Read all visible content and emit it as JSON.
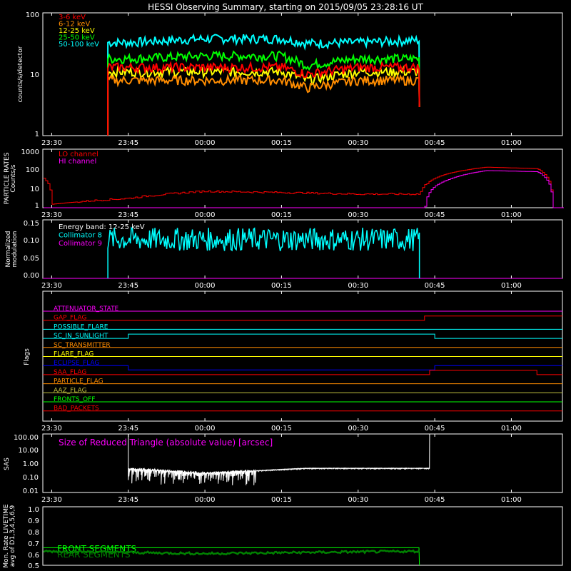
{
  "title": "HESSI Observing Summary, starting on 2015/09/05 23:28:16 UT",
  "time_ticks": [
    "23:30",
    "23:45",
    "00:00",
    "00:15",
    "00:30",
    "00:45",
    "01:00"
  ],
  "panels": {
    "counts": {
      "ylabel": "counts/s/detector",
      "ticks": [
        "100",
        "10",
        "1"
      ],
      "legend": [
        {
          "label": "3-6 keV",
          "color": "#ff0000"
        },
        {
          "label": "6-12 keV",
          "color": "#ff8c00"
        },
        {
          "label": "12-25 keV",
          "color": "#ffff00"
        },
        {
          "label": "25-50 keV",
          "color": "#00ff00"
        },
        {
          "label": "50-100 keV",
          "color": "#00ffff"
        }
      ]
    },
    "particle": {
      "ylabel1": "PARTICLE RATES",
      "ylabel2": "Counts/s",
      "ticks": [
        "1000",
        "100",
        "10",
        "1"
      ],
      "legend": [
        {
          "label": "LO channel",
          "color": "#ff0000"
        },
        {
          "label": "HI channel",
          "color": "#ff00ff"
        }
      ]
    },
    "modulation": {
      "ylabel1": "Normalized",
      "ylabel2": "modulation",
      "ticks": [
        "0.15",
        "0.10",
        "0.05",
        "0.00"
      ],
      "legend": [
        {
          "label": "Energy band: 12-25 keV",
          "color": "#ffffff"
        },
        {
          "label": "Collimator 8",
          "color": "#00ffff"
        },
        {
          "label": "Collimator 9",
          "color": "#ff00ff"
        }
      ]
    },
    "flags": {
      "ylabel": "Flags",
      "items": [
        {
          "label": "ATTENUATOR_STATE",
          "color": "#ff00ff"
        },
        {
          "label": "GAP_FLAG",
          "color": "#ff0000"
        },
        {
          "label": "POSSIBLE_FLARE",
          "color": "#00ffff"
        },
        {
          "label": "SC_IN_SUNLIGHT",
          "color": "#00ffff"
        },
        {
          "label": "SC_TRANSMITTER",
          "color": "#ff8c00"
        },
        {
          "label": "FLARE_FLAG",
          "color": "#ffff00"
        },
        {
          "label": "ECLIPSE_FLAG",
          "color": "#0000ff"
        },
        {
          "label": "SAA_FLAG",
          "color": "#ff0000"
        },
        {
          "label": "PARTICLE_FLAG",
          "color": "#ff8c00"
        },
        {
          "label": "AAZ_FLAG",
          "color": "#c0c040"
        },
        {
          "label": "FRONTS_OFF",
          "color": "#00ff00"
        },
        {
          "label": "BAD_PACKETS",
          "color": "#ff0000"
        }
      ]
    },
    "sas": {
      "ylabel": "SAS",
      "ticks": [
        "100.00",
        "10.00",
        "1.00",
        "0.10",
        "0.01"
      ],
      "label": "Size of Reduced Triangle (absolute value) [arcsec]",
      "label_color": "#ff00ff"
    },
    "livetime": {
      "ylabel1": "Mon. Rate LIVETIME",
      "ylabel2": "avg of D1,3,4,5,6,9",
      "ticks": [
        "1.0",
        "0.9",
        "0.8",
        "0.7",
        "0.6",
        "0.5"
      ],
      "legend": [
        {
          "label": "FRONT SEGMENTS",
          "color": "#00ff00"
        },
        {
          "label": "REAR SEGMENTS",
          "color": "#008000"
        }
      ]
    }
  },
  "chart_data": [
    {
      "type": "line",
      "title": "HESSI Observing Summary, starting on 2015/09/05 23:28:16 UT",
      "ylabel": "counts/s/detector",
      "yscale": "log",
      "ylim": [
        1,
        100
      ],
      "x_range": [
        "23:28:16",
        "01:10"
      ],
      "series": [
        {
          "name": "3-6 keV",
          "x": [
            "23:41",
            "23:45",
            "00:00",
            "00:15",
            "00:20",
            "00:30",
            "00:42"
          ],
          "values": [
            13,
            13,
            13,
            13,
            10,
            13,
            13
          ]
        },
        {
          "name": "6-12 keV",
          "x": [
            "23:41",
            "23:45",
            "00:00",
            "00:15",
            "00:20",
            "00:30",
            "00:42"
          ],
          "values": [
            8,
            8,
            8,
            8,
            6,
            8,
            8
          ]
        },
        {
          "name": "12-25 keV",
          "x": [
            "23:41",
            "23:45",
            "00:00",
            "00:15",
            "00:20",
            "00:30",
            "00:42"
          ],
          "values": [
            11,
            11,
            11,
            11,
            8,
            11,
            11
          ]
        },
        {
          "name": "25-50 keV",
          "x": [
            "23:41",
            "23:45",
            "00:00",
            "00:15",
            "00:20",
            "00:30",
            "00:42"
          ],
          "values": [
            18,
            18,
            20,
            20,
            14,
            18,
            18
          ]
        },
        {
          "name": "50-100 keV",
          "x": [
            "23:41",
            "23:45",
            "00:00",
            "00:15",
            "00:20",
            "00:30",
            "00:42"
          ],
          "values": [
            33,
            33,
            38,
            38,
            32,
            33,
            36
          ]
        }
      ]
    },
    {
      "type": "line",
      "ylabel": "PARTICLE RATES Counts/s",
      "yscale": "log",
      "ylim": [
        1,
        1000
      ],
      "series": [
        {
          "name": "LO channel",
          "x": [
            "23:28",
            "23:30",
            "23:45",
            "00:00",
            "00:30",
            "00:42",
            "00:48",
            "00:55",
            "01:05",
            "01:08"
          ],
          "values": [
            40,
            1.5,
            3,
            7,
            5,
            5,
            60,
            120,
            100,
            1
          ]
        },
        {
          "name": "HI channel",
          "x": [
            "23:28",
            "23:45",
            "00:43",
            "00:48",
            "00:55",
            "01:05",
            "01:08"
          ],
          "values": [
            1,
            1,
            1,
            30,
            80,
            70,
            1
          ]
        }
      ]
    },
    {
      "type": "line",
      "ylabel": "Normalized modulation",
      "ylim": [
        0,
        0.15
      ],
      "series": [
        {
          "name": "Collimator 8",
          "x": [
            "23:41",
            "00:00",
            "00:20",
            "00:42"
          ],
          "values": [
            0.1,
            0.1,
            0.1,
            0.1
          ]
        },
        {
          "name": "Collimator 9",
          "x": [
            "23:28",
            "01:10"
          ],
          "values": [
            0,
            0
          ]
        }
      ]
    },
    {
      "type": "line",
      "ylabel": "SAS",
      "yscale": "log",
      "ylim": [
        0.01,
        100
      ],
      "series": [
        {
          "name": "Size of Reduced Triangle (absolute value) [arcsec]",
          "x": [
            "23:45",
            "00:00",
            "00:10",
            "00:20",
            "00:44"
          ],
          "values": [
            0.4,
            0.2,
            0.3,
            0.45,
            0.45
          ]
        }
      ]
    },
    {
      "type": "line",
      "ylabel": "Mon. Rate LIVETIME avg of D1,3,4,5,6,9",
      "ylim": [
        0.5,
        1.0
      ],
      "series": [
        {
          "name": "FRONT SEGMENTS",
          "x": [
            "23:28",
            "00:42"
          ],
          "values": [
            0.65,
            0.65
          ]
        },
        {
          "name": "REAR SEGMENTS",
          "x": [
            "23:28",
            "00:00",
            "00:20",
            "00:42"
          ],
          "values": [
            0.62,
            0.6,
            0.61,
            0.62
          ]
        }
      ]
    }
  ]
}
